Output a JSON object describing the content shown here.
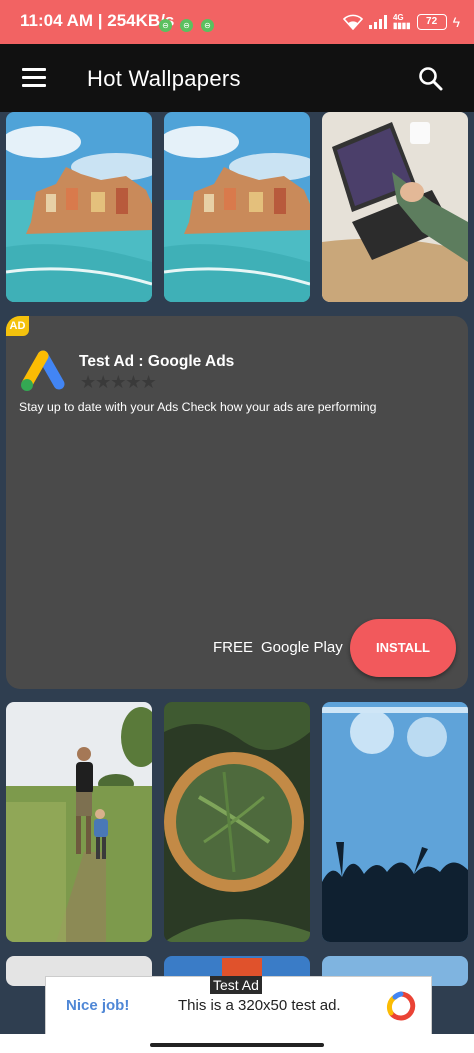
{
  "status_bar": {
    "time": "11:04 AM | 254KB/s",
    "icons": [
      "notification-icon",
      "notification-icon",
      "notification-icon",
      "wifi-icon",
      "signal-icon",
      "signal-4g-icon",
      "battery-icon",
      "charging-icon"
    ],
    "network": "4G",
    "battery": "72"
  },
  "toolbar": {
    "title": "Hot Wallpapers",
    "menu_icon": "hamburger-menu-icon",
    "search_icon": "search-icon"
  },
  "ad": {
    "badge": "AD",
    "title": "Test Ad : Google Ads",
    "description": "Stay up to date with your Ads Check how your ads are performing",
    "rating_stars": "★★★★★",
    "price": "FREE",
    "store": "Google Play",
    "cta": "INSTALL",
    "colors": {
      "card": "#4a4a4a",
      "cta": "#f2595c",
      "badge": "#f4c20d"
    }
  },
  "banner_ad": {
    "label": "Test Ad",
    "left_text": "Nice job!",
    "text": "This is a 320x50 test ad."
  },
  "colors": {
    "status_bar": "#f26363",
    "toolbar": "#111111",
    "background": "#2f3e50"
  }
}
